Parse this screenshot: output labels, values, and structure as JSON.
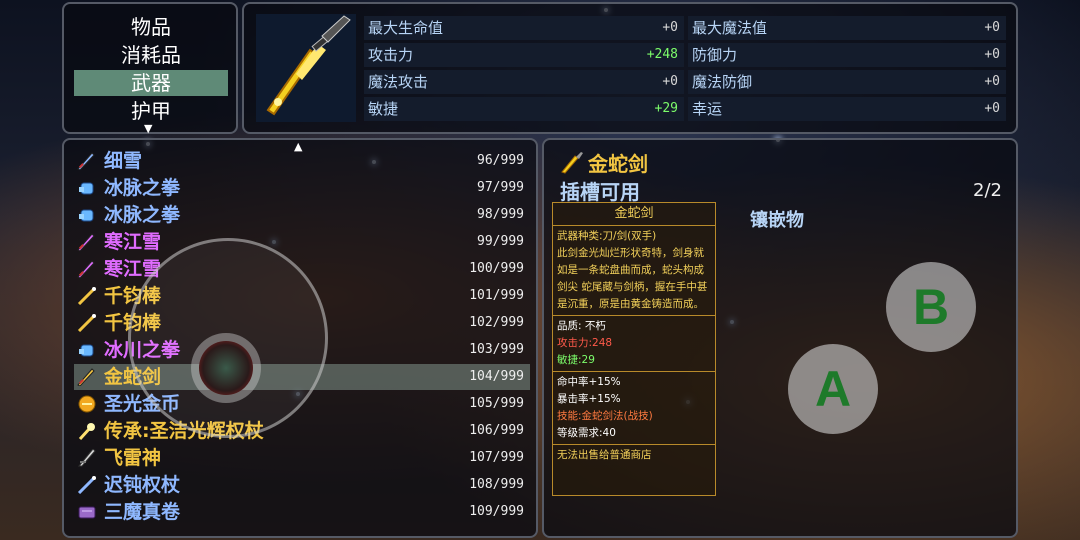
{
  "categories": [
    {
      "label": "物品",
      "selected": false
    },
    {
      "label": "消耗品",
      "selected": false
    },
    {
      "label": "武器",
      "selected": true
    },
    {
      "label": "护甲",
      "selected": false
    }
  ],
  "stats": [
    {
      "label": "最大生命值",
      "value": "+0",
      "highlight": false
    },
    {
      "label": "最大魔法值",
      "value": "+0",
      "highlight": false
    },
    {
      "label": "攻击力",
      "value": "+248",
      "highlight": true
    },
    {
      "label": "防御力",
      "value": "+0",
      "highlight": false
    },
    {
      "label": "魔法攻击",
      "value": "+0",
      "highlight": false
    },
    {
      "label": "魔法防御",
      "value": "+0",
      "highlight": false
    },
    {
      "label": "敏捷",
      "value": "+29",
      "highlight": true
    },
    {
      "label": "幸运",
      "value": "+0",
      "highlight": false
    }
  ],
  "items": [
    {
      "name": "细雪",
      "count": "96/999",
      "color": "#8fb8ff",
      "icon": "sword-icon"
    },
    {
      "name": "冰脉之拳",
      "count": "97/999",
      "color": "#8fb8ff",
      "icon": "gauntlet-icon"
    },
    {
      "name": "冰脉之拳",
      "count": "98/999",
      "color": "#8fb8ff",
      "icon": "gauntlet-icon"
    },
    {
      "name": "寒江雪",
      "count": "99/999",
      "color": "#e06cff",
      "icon": "sword-icon"
    },
    {
      "name": "寒江雪",
      "count": "100/999",
      "color": "#e06cff",
      "icon": "sword-icon"
    },
    {
      "name": "千钧棒",
      "count": "101/999",
      "color": "#f2c542",
      "icon": "staff-icon"
    },
    {
      "name": "千钧棒",
      "count": "102/999",
      "color": "#f2c542",
      "icon": "staff-icon"
    },
    {
      "name": "冰川之拳",
      "count": "103/999",
      "color": "#e06cff",
      "icon": "gauntlet-icon"
    },
    {
      "name": "金蛇剑",
      "count": "104/999",
      "color": "#f2c542",
      "icon": "sword-icon",
      "selected": true
    },
    {
      "name": "圣光金币",
      "count": "105/999",
      "color": "#8fb8ff",
      "icon": "coin-icon"
    },
    {
      "name": "传承:圣洁光辉权杖",
      "count": "106/999",
      "color": "#f2c542",
      "icon": "scepter-icon"
    },
    {
      "name": "飞雷神",
      "count": "107/999",
      "color": "#f2c542",
      "icon": "dagger-icon"
    },
    {
      "name": "迟钝权杖",
      "count": "108/999",
      "color": "#8fb8ff",
      "icon": "staff-icon"
    },
    {
      "name": "三魔真卷",
      "count": "109/999",
      "color": "#8fb8ff",
      "icon": "scroll-icon"
    }
  ],
  "detail": {
    "title": "金蛇剑",
    "slot_label": "插槽可用",
    "slot_count": "2/2",
    "inlay_label": "镶嵌物",
    "box_name": "金蛇剑",
    "type_line": "武器种类:刀/剑(双手)",
    "description": "此剑金光灿烂形状奇特，剑身就如是一条蛇盘曲而成，蛇头构成剑尖 蛇尾藏与剑柄，握在手中甚是沉重，原是由黄金铸造而成。",
    "quality": "品质: 不朽",
    "attack": "攻击力:248",
    "agility": "敏捷:29",
    "hit_rate": "命中率+15%",
    "crit_rate": "暴击率+15%",
    "skill": "技能:金蛇剑法(战技)",
    "level_req": "等级需求:40",
    "sell_note": "无法出售给普通商店"
  },
  "controls": {
    "a_label": "A",
    "b_label": "B"
  },
  "colors": {
    "selected_row": "#5f8a77",
    "gold": "#f2c542",
    "highlight_green": "#7cfc6a"
  }
}
